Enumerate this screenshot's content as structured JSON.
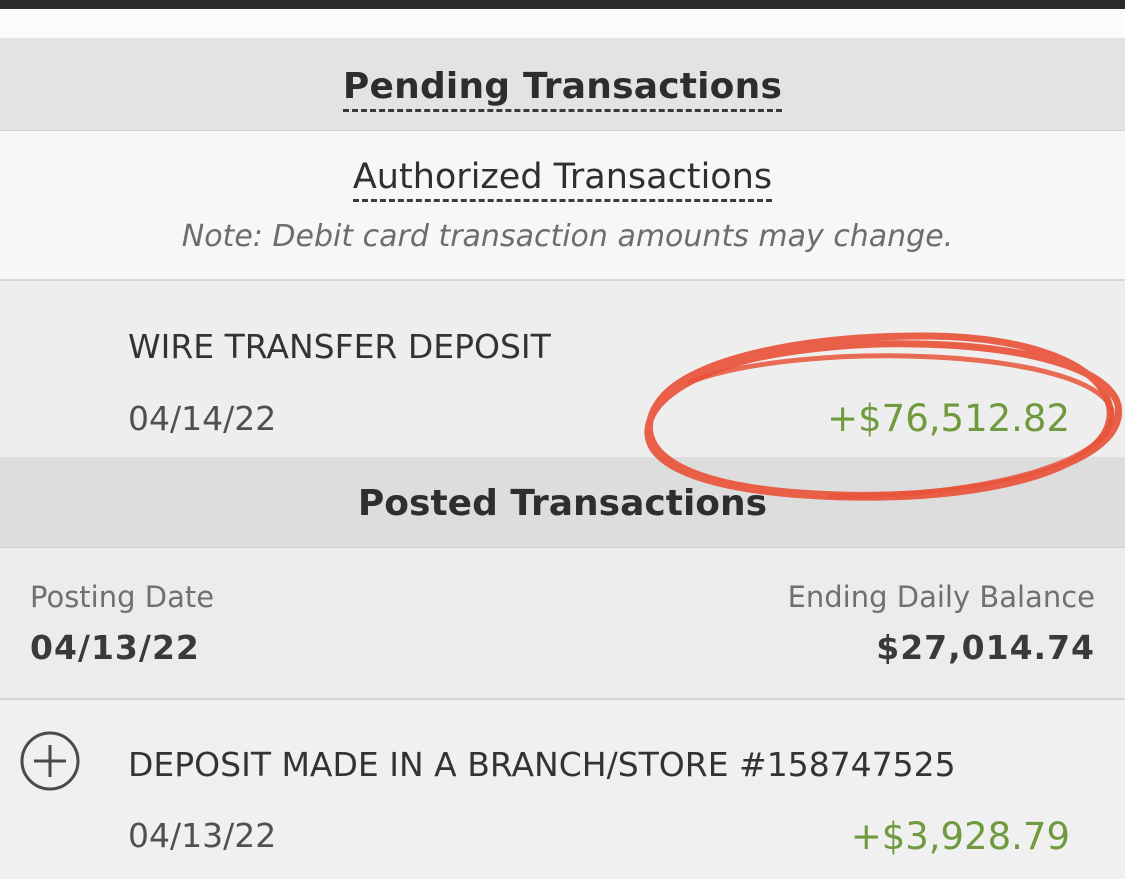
{
  "pending": {
    "title": "Pending Transactions"
  },
  "authorized": {
    "title": "Authorized Transactions",
    "note": "Note: Debit card transaction amounts may change."
  },
  "pending_items": [
    {
      "description": "WIRE TRANSFER DEPOSIT",
      "date": "04/14/22",
      "amount": "+$76,512.82"
    }
  ],
  "posted": {
    "title": "Posted Transactions",
    "posting_date_label": "Posting Date",
    "posting_date": "04/13/22",
    "ending_balance_label": "Ending Daily Balance",
    "ending_balance": "$27,014.74",
    "items": [
      {
        "description": "DEPOSIT MADE IN A BRANCH/STORE #158747525",
        "date": "04/13/22",
        "amount": "+$3,928.79"
      }
    ]
  },
  "colors": {
    "amount_positive": "#6f9a3e",
    "annotation_circle": "#e8533a",
    "header_bg": "#e3e3e3"
  },
  "icons": {
    "expand": "plus-circle-icon"
  }
}
